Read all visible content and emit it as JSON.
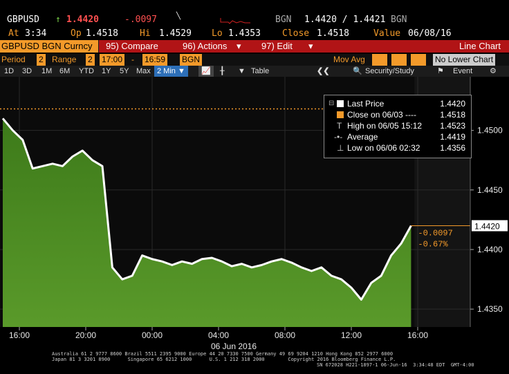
{
  "header": {
    "ticker": "GBPUSD",
    "arrow": "↑",
    "last": "1.4420",
    "change": "-.0097",
    "source_label": "BGN",
    "bid_ask": "1.4420 / 1.4421",
    "source_label2": "BGN",
    "at_label": "At",
    "at_time": "3:34",
    "op_label": "Op",
    "op_value": "1.4518",
    "hi_label": "Hi",
    "hi_value": "1.4529",
    "lo_label": "Lo",
    "lo_value": "1.4353",
    "close_label": "Close",
    "close_value": "1.4518",
    "value_label": "Value",
    "value_date": "06/08/16"
  },
  "menubar": {
    "security": "GBPUSD BGN Curncy",
    "compare": "95) Compare",
    "actions": "96) Actions",
    "edit": "97) Edit",
    "chart_title": "Line Chart"
  },
  "period_row": {
    "period_label": "Period",
    "period_value": "2",
    "range_label": "Range",
    "range_value": "2",
    "time_from": "17:00",
    "time_to": "16:59",
    "source": "BGN",
    "mov_avg_label": "Mov Avg",
    "lower_chart": "No Lower Chart"
  },
  "timeframes": {
    "items": [
      "1D",
      "3D",
      "1M",
      "6M",
      "YTD",
      "1Y",
      "5Y",
      "Max"
    ],
    "interval": "2 Min",
    "table": "Table",
    "security_study": "Security/Study",
    "event": "Event"
  },
  "legend": {
    "rows": [
      {
        "label": "Last Price",
        "value": "1.4420"
      },
      {
        "label": "Close on 06/03 ----",
        "value": "1.4518"
      },
      {
        "label": "High on 06/05 15:12",
        "value": "1.4523"
      },
      {
        "label": "Average",
        "value": "1.4419"
      },
      {
        "label": "Low on 06/06 02:32",
        "value": "1.4356"
      }
    ]
  },
  "annotations": {
    "change_abs": "-0.0097",
    "change_pct": "-0.67%",
    "last_tag": "1.4420"
  },
  "chart_data": {
    "type": "area",
    "yticks": [
      "1.4500",
      "1.4450",
      "1.4400",
      "1.4350"
    ],
    "ylim": [
      1.4335,
      1.4545
    ],
    "xlabels": [
      "16:00",
      "20:00",
      "00:00",
      "04:00",
      "08:00",
      "12:00",
      "16:00"
    ],
    "date_label": "06 Jun 2016",
    "close_ref": 1.4518,
    "last": 1.442,
    "series": [
      {
        "x": [
          0,
          0.3,
          0.6,
          0.9,
          1.2,
          1.5,
          1.8,
          2.1,
          2.4,
          2.7,
          3.0,
          3.3,
          3.6,
          3.9,
          4.2,
          4.5,
          4.8,
          5.1,
          5.4,
          5.7,
          6.0,
          6.3,
          6.6,
          6.9,
          7.2,
          7.5,
          7.8,
          8.1,
          8.4,
          8.7,
          9.0,
          9.3,
          9.6,
          9.9,
          10.2,
          10.5,
          10.8,
          11.1,
          11.4,
          11.7,
          12.0,
          12.3
        ],
        "y": [
          1.451,
          1.45,
          1.4492,
          1.4468,
          1.447,
          1.4472,
          1.447,
          1.4478,
          1.4483,
          1.4475,
          1.447,
          1.4385,
          1.4375,
          1.4378,
          1.4395,
          1.4392,
          1.439,
          1.4387,
          1.439,
          1.4388,
          1.4392,
          1.4393,
          1.439,
          1.4386,
          1.4388,
          1.4385,
          1.4387,
          1.439,
          1.4392,
          1.4389,
          1.4385,
          1.4382,
          1.4385,
          1.4378,
          1.4375,
          1.4368,
          1.4358,
          1.4372,
          1.4378,
          1.4395,
          1.4405,
          1.442
        ]
      }
    ]
  }
}
